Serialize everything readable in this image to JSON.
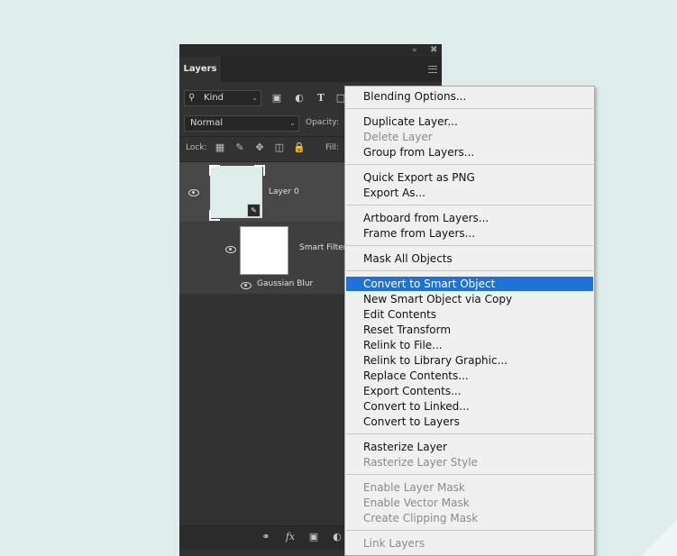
{
  "panel": {
    "tab_label": "Layers",
    "kind_label": "Kind",
    "blend_mode": "Normal",
    "opacity_label": "Opacity:",
    "lock_label": "Lock:",
    "fill_label": "Fill:"
  },
  "layers": {
    "layer0": {
      "name": "Layer 0"
    },
    "smart_filters": {
      "name": "Smart Filters"
    },
    "filter_item": {
      "name": "Gaussian Blur"
    }
  },
  "menu": {
    "items": [
      {
        "label": "Blending Options...",
        "disabled": false
      },
      {
        "label": "Duplicate Layer...",
        "disabled": false
      },
      {
        "label": "Delete Layer",
        "disabled": true
      },
      {
        "label": "Group from Layers...",
        "disabled": false
      },
      {
        "label": "Quick Export as PNG",
        "disabled": false
      },
      {
        "label": "Export As...",
        "disabled": false
      },
      {
        "label": "Artboard from Layers...",
        "disabled": false
      },
      {
        "label": "Frame from Layers...",
        "disabled": false
      },
      {
        "label": "Mask All Objects",
        "disabled": false
      },
      {
        "label": "Convert to Smart Object",
        "disabled": false,
        "highlighted": true
      },
      {
        "label": "New Smart Object via Copy",
        "disabled": false
      },
      {
        "label": "Edit Contents",
        "disabled": false
      },
      {
        "label": "Reset Transform",
        "disabled": false
      },
      {
        "label": "Relink to File...",
        "disabled": false
      },
      {
        "label": "Relink to Library Graphic...",
        "disabled": false
      },
      {
        "label": "Replace Contents...",
        "disabled": false
      },
      {
        "label": "Export Contents...",
        "disabled": false
      },
      {
        "label": "Convert to Linked...",
        "disabled": false
      },
      {
        "label": "Convert to Layers",
        "disabled": false
      },
      {
        "label": "Rasterize Layer",
        "disabled": false
      },
      {
        "label": "Rasterize Layer Style",
        "disabled": true
      },
      {
        "label": "Enable Layer Mask",
        "disabled": true
      },
      {
        "label": "Enable Vector Mask",
        "disabled": true
      },
      {
        "label": "Create Clipping Mask",
        "disabled": true
      },
      {
        "label": "Link Layers",
        "disabled": true
      }
    ]
  },
  "colors": {
    "background": "#deedeb",
    "panel": "#323232",
    "selected_row": "#474747",
    "menu_background": "#f0f0f0",
    "menu_highlight": "#1d73d5",
    "menu_disabled_text": "#8a8a8a"
  }
}
